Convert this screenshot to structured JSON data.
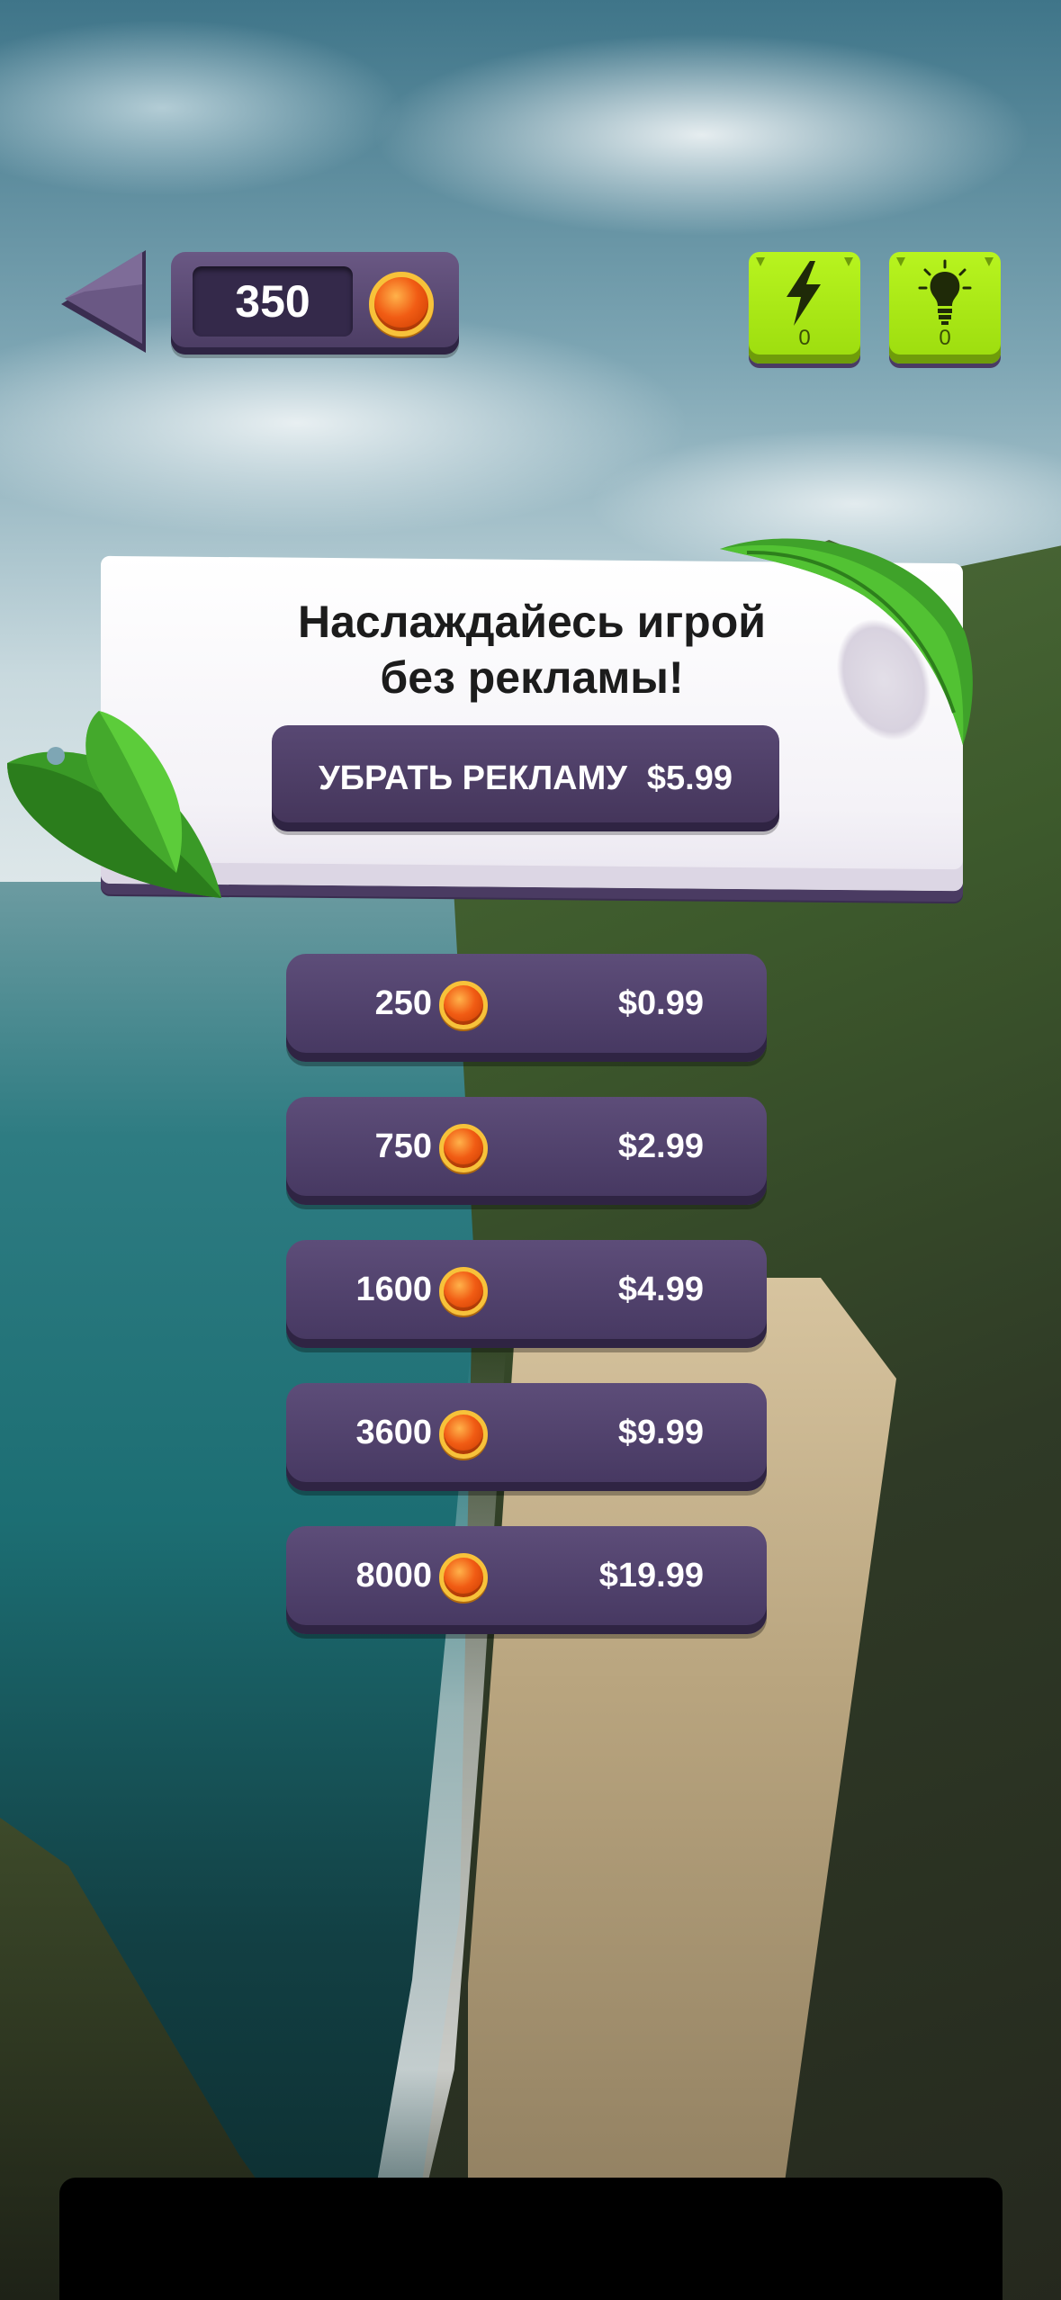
{
  "header": {
    "coins": "350",
    "powerups": [
      {
        "icon": "lightning-icon",
        "count": "0"
      },
      {
        "icon": "lightbulb-icon",
        "count": "0"
      }
    ]
  },
  "promo": {
    "title_line1": "Наслаждайесь игрой",
    "title_line2": "без рекламы!",
    "button_label": "УБРАТЬ РЕКЛАМУ",
    "button_price": "$5.99"
  },
  "packs": [
    {
      "amount": "250",
      "price": "$0.99"
    },
    {
      "amount": "750",
      "price": "$2.99"
    },
    {
      "amount": "1600",
      "price": "$4.99"
    },
    {
      "amount": "3600",
      "price": "$9.99"
    },
    {
      "amount": "8000",
      "price": "$19.99"
    }
  ],
  "colors": {
    "panel_purple": "#4a3b62",
    "powerup_green": "#9cdc0e",
    "coin_orange": "#f15c14",
    "leaf_green": "#3fa22a"
  }
}
